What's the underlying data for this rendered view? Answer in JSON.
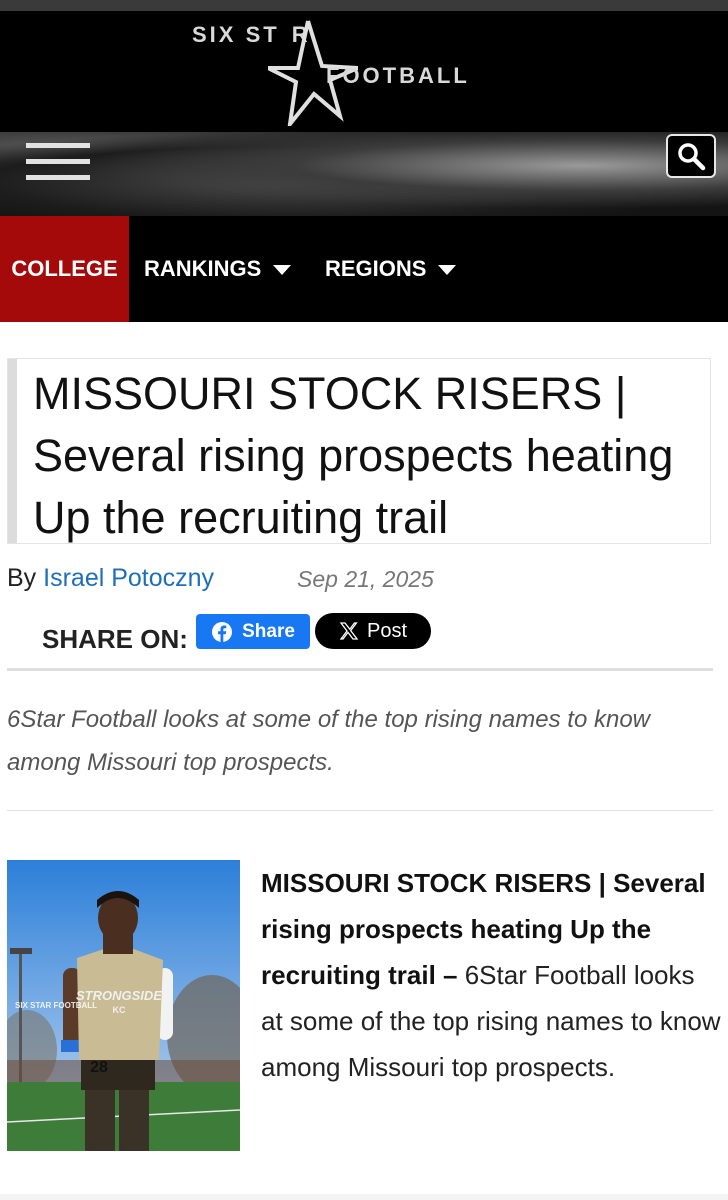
{
  "brand": {
    "logo_six": "SIX ST",
    "logo_r": "R",
    "logo_football": "FOOTBALL"
  },
  "nav": {
    "items": [
      {
        "label": "COLLEGE",
        "active": true
      },
      {
        "label": "RANKINGS",
        "dropdown": true
      },
      {
        "label": "REGIONS",
        "dropdown": true
      }
    ]
  },
  "article": {
    "title": "MISSOURI STOCK RISERS | Several rising prospects heating Up the recruiting trail",
    "by": "By",
    "author": "Israel Potoczny",
    "date": "Sep 21, 2025",
    "share_label": "SHARE ON:",
    "facebook_label": "Share",
    "x_label": "Post",
    "excerpt": "6Star Football looks at some of the top rising names to know among Missouri top prospects.",
    "card": {
      "bold": "MISSOURI STOCK RISERS | Several rising prospects heating Up the recruiting trail –",
      "text": " 6Star Football looks at some of the top rising names to know among Missouri top prospects."
    }
  },
  "photo": {
    "jersey_text": "STRONGSIDE",
    "jersey_sub": "KC",
    "jersey_number": "28",
    "watermark": "SIX STAR FOOTBALL"
  },
  "colors": {
    "accent_red": "#a50a0a",
    "facebook_blue": "#1877f2",
    "link_blue": "#1e6fb8"
  },
  "icons": [
    "hamburger-menu-icon",
    "search-icon",
    "facebook-icon",
    "x-logo-icon",
    "caret-down-icon"
  ]
}
